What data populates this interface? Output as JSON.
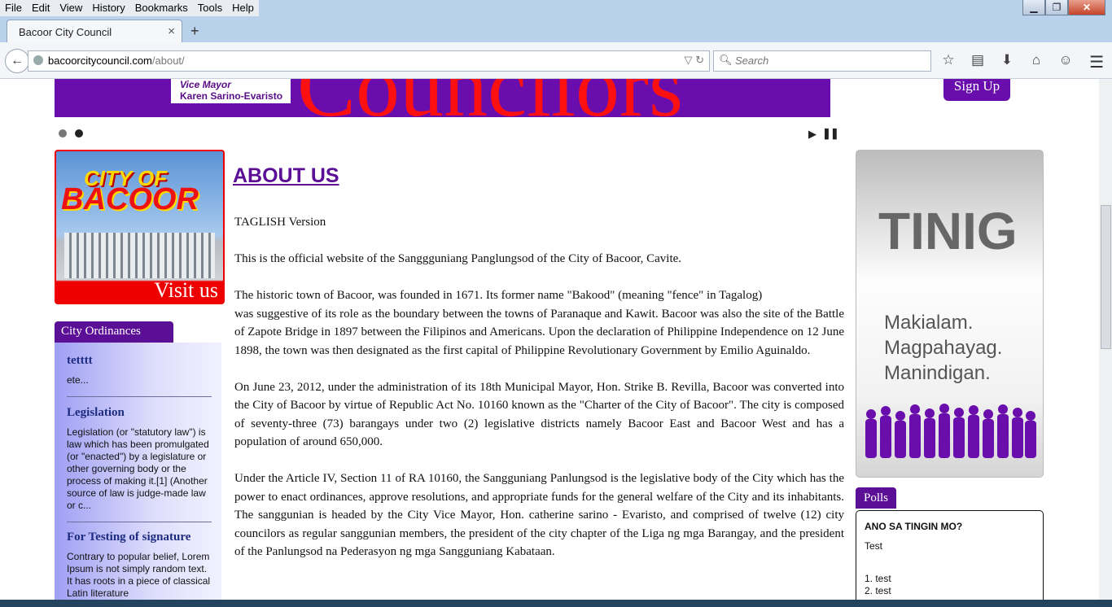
{
  "browser": {
    "menu": [
      "File",
      "Edit",
      "View",
      "History",
      "Bookmarks",
      "Tools",
      "Help"
    ],
    "tab_title": "Bacoor City Council",
    "url_host": "bacoorcitycouncil.com",
    "url_path": "/about/",
    "search_placeholder": "Search"
  },
  "banner": {
    "vice_mayor_label": "Vice Mayor",
    "vice_mayor_name": "Karen Sarino-Evaristo",
    "big_text": "Councilors",
    "signup_label": "Sign Up"
  },
  "slider": {
    "dot_count": 2,
    "active_index": 1
  },
  "city_image": {
    "line1": "CITY OF",
    "line2": "BACOOR",
    "visit": "Visit us"
  },
  "ordinances": {
    "tab_label": "City Ordinances",
    "items": [
      {
        "title": "tetttt",
        "text": "ete..."
      },
      {
        "title": "Legislation",
        "text": "Legislation (or \"statutory law\") is law which has been promulgated (or \"enacted\") by a legislature or other governing body or the process of making it.[1] (Another source of law is judge-made law or c..."
      },
      {
        "title": "For Testing of signature",
        "text": "Contrary to popular belief, Lorem Ipsum is not simply random text. It has roots in a piece of classical Latin literature"
      }
    ]
  },
  "main": {
    "heading": "ABOUT US",
    "version": "TAGLISH Version",
    "p1": "This is the official website of the Sanggguniang Panglungsod of the City of Bacoor, Cavite.",
    "p2a": "The historic town of Bacoor, was founded in 1671. Its former name \"Bakood\" (meaning \"fence\" in Tagalog)",
    "p2b": "was suggestive of its role as the boundary between the towns of Paranaque and Kawit. Bacoor was also the site of the Battle of Zapote Bridge in 1897 between the Filipinos and Americans. Upon the declaration of Philippine Independence on 12 June 1898, the town was then designated as the first capital of Philippine Revolutionary Government by Emilio Aguinaldo.",
    "p3": "On June 23, 2012, under the administration of its 18th Municipal Mayor, Hon. Strike B. Revilla, Bacoor was converted into the City of Bacoor by virtue of Republic Act No. 10160 known as the \"Charter of the City of Bacoor\". The city is composed of seventy-three (73) barangays under two (2) legislative districts namely Bacoor East and Bacoor West and has a population of around 650,000.",
    "p4": "Under the Article IV, Section 11 of RA 10160, the Sangguniang Panlungsod is the legislative body of the City which has the power to enact ordinances, approve resolutions, and appropriate funds for the general welfare of the City and its inhabitants. The sanggunian is headed by the City Vice Mayor, Hon. catherine sarino - Evaristo, and comprised of twelve (12) city councilors as regular sanggunian members, the president of the city chapter of the Liga ng mga Barangay, and the president of the Panlungsod na Pederasyon ng mga Sangguniang Kabataan."
  },
  "tinig": {
    "title": "TINIG",
    "line1": "Makialam.",
    "line2": "Magpahayag.",
    "line3": "Manindigan."
  },
  "polls": {
    "tab_label": "Polls",
    "question": "ANO SA TINGIN MO?",
    "description": "Test",
    "options": [
      "1. test",
      "2. test"
    ]
  },
  "colors": {
    "brand_purple": "#5b0e96",
    "banner_purple": "#6a0dad",
    "banner_red": "#ff1010"
  }
}
